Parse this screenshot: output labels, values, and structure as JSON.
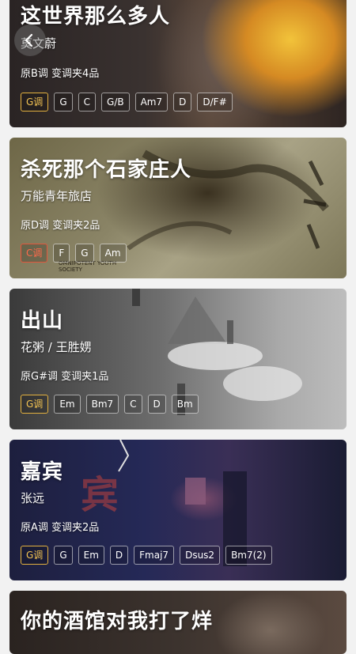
{
  "songs": [
    {
      "title": "这世界那么多人",
      "artist": "莫文蔚",
      "info": "原B调 变调夹4品",
      "chords": [
        "G调",
        "G",
        "C",
        "G/B",
        "Am7",
        "D",
        "D/F#"
      ]
    },
    {
      "title": "杀死那个石家庄人",
      "artist": "万能青年旅店",
      "info": "原D调 变调夹2品",
      "chords": [
        "C调",
        "F",
        "G",
        "Am"
      ],
      "cover_text": "OMNIPOTENT YOUTH SOCIETY"
    },
    {
      "title": "出山",
      "artist": "花粥 / 王胜娚",
      "info": "原G#调 变调夹1品",
      "chords": [
        "G调",
        "Em",
        "Bm7",
        "C",
        "D",
        "Bm"
      ]
    },
    {
      "title": "嘉宾",
      "artist": "张远",
      "info": "原A调 变调夹2品",
      "chords": [
        "G调",
        "G",
        "Em",
        "D",
        "Fmaj7",
        "Dsus2",
        "Bm7(2)"
      ],
      "cover_text": "宾"
    },
    {
      "title": "你的酒馆对我打了烊"
    }
  ],
  "colors": {
    "key_chip": "#f1c253",
    "key_chip_alt": "#ff6a4b"
  },
  "icons": {
    "back": "chevron-left-icon"
  }
}
